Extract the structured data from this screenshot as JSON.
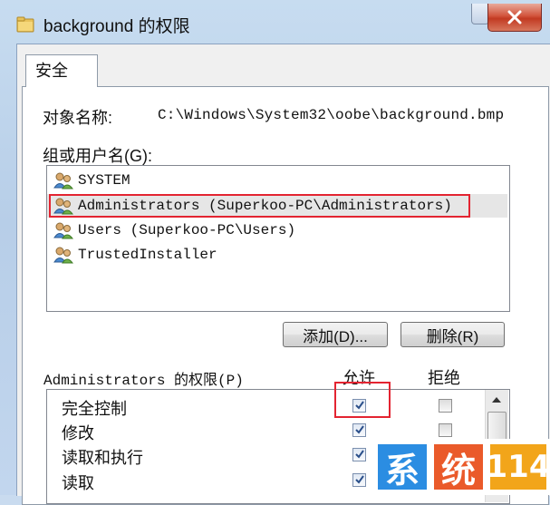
{
  "window": {
    "title": "background 的权限"
  },
  "tabs": [
    {
      "label": "安全",
      "selected": true
    }
  ],
  "object": {
    "label": "对象名称:",
    "path": "C:\\Windows\\System32\\oobe\\background.bmp"
  },
  "groups": {
    "label": "组或用户名(G):",
    "items": [
      {
        "name": "SYSTEM",
        "icon": "users-icon",
        "selected": false
      },
      {
        "name": "Administrators (Superkoo-PC\\Administrators)",
        "icon": "users-icon",
        "selected": true
      },
      {
        "name": "Users (Superkoo-PC\\Users)",
        "icon": "users-icon",
        "selected": false
      },
      {
        "name": "TrustedInstaller",
        "icon": "users-icon",
        "selected": false
      }
    ]
  },
  "buttons": {
    "add": "添加(D)...",
    "remove": "删除(R)"
  },
  "permissions": {
    "label": "Administrators 的权限(P)",
    "allow_header": "允许",
    "deny_header": "拒绝",
    "rows": [
      {
        "name": "完全控制",
        "allow": true,
        "deny": false
      },
      {
        "name": "修改",
        "allow": true,
        "deny": false
      },
      {
        "name": "读取和执行",
        "allow": true,
        "deny": false
      },
      {
        "name": "读取",
        "allow": true,
        "deny": false
      }
    ]
  },
  "watermark": {
    "chars": [
      "系",
      "统",
      "114"
    ],
    "colors": [
      "#2b8de2",
      "#ea5a2a",
      "#f2a51a"
    ]
  },
  "colors": {
    "highlight": "#e32431"
  }
}
